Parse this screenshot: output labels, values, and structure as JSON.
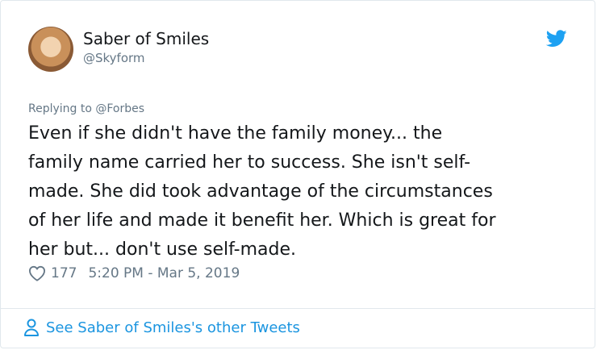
{
  "tweet": {
    "author": {
      "display_name": "Saber of Smiles",
      "handle": "@Skyform",
      "avatar_icon": "avatar"
    },
    "replying_to": "Replying to @Forbes",
    "text": "Even if she didn't have the family money... the\nfamily name carried her to success. She isn't self-\nmade. She did took advantage of the circumstances\nof her life and made it benefit her. Which is great for\nher but... don't use self-made.",
    "likes": "177",
    "timestamp": "5:20 PM - Mar 5, 2019"
  },
  "footer": {
    "link_label": "See Saber of Smiles's other Tweets"
  },
  "colors": {
    "link": "#1b95e0",
    "muted": "#657786",
    "text": "#14171a",
    "twitter_blue": "#1da1f2"
  },
  "icons": {
    "brand": "twitter-bird-icon",
    "like": "heart-icon",
    "profile": "person-icon"
  }
}
